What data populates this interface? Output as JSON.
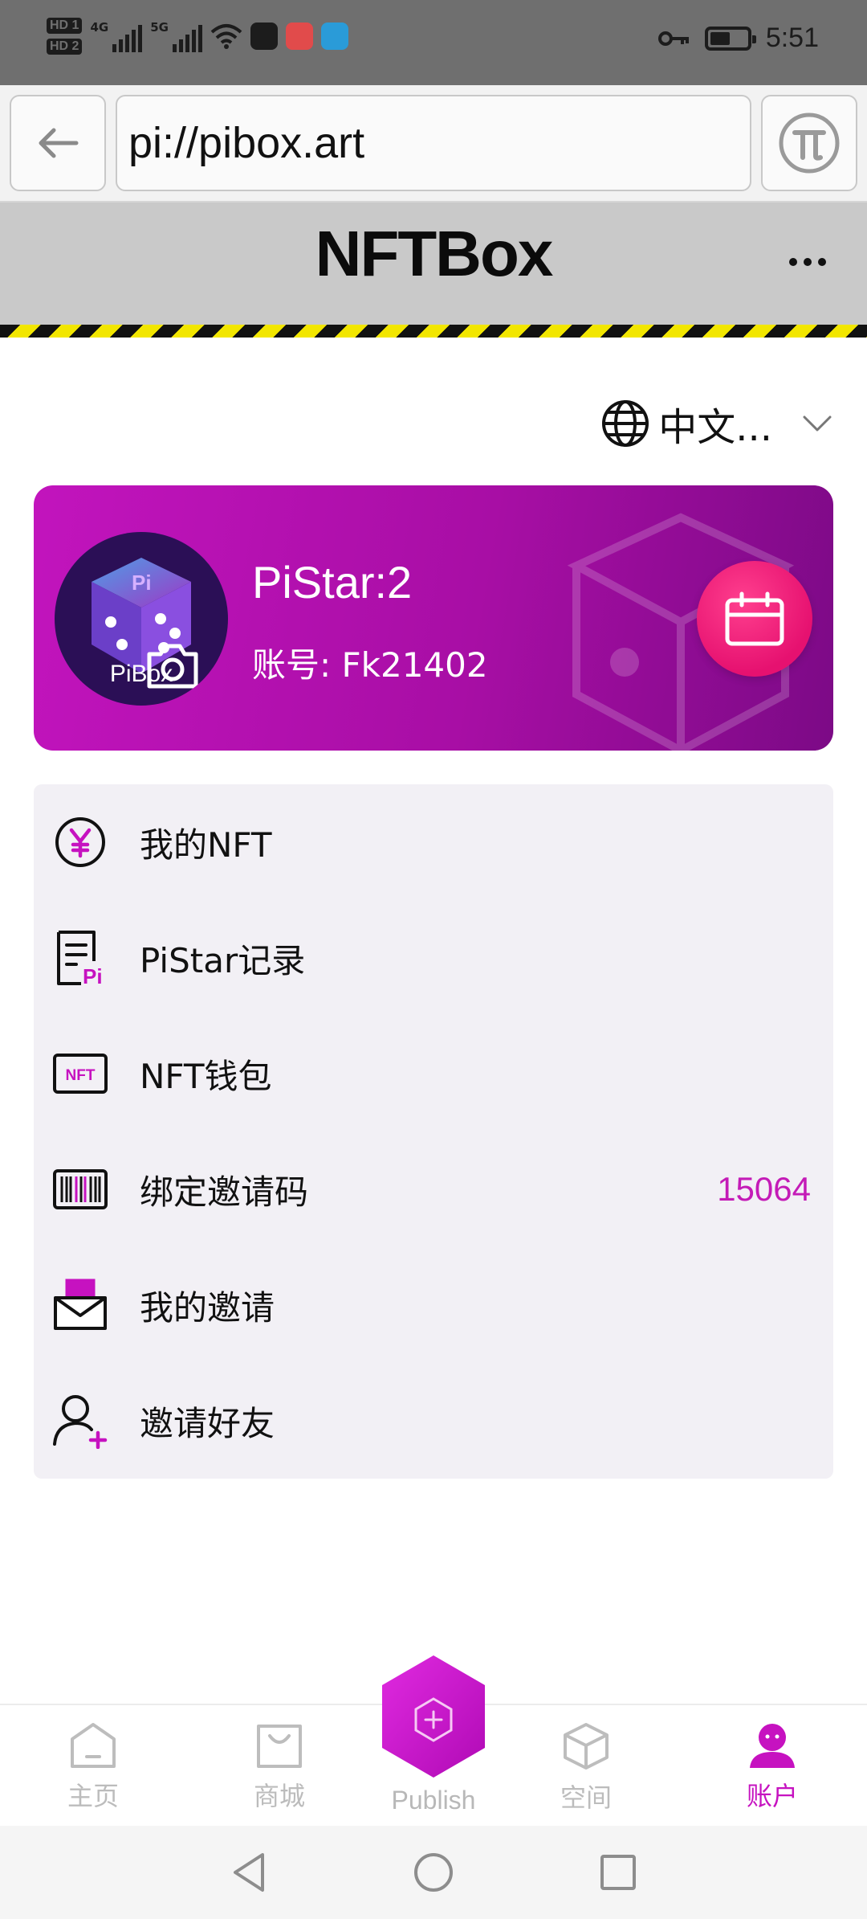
{
  "status_bar": {
    "hd1": "HD 1",
    "hd2": "HD 2",
    "net1": "4G",
    "net2": "5G",
    "time": "5:51",
    "battery_percent": 55
  },
  "browser": {
    "url": "pi://pibox.art"
  },
  "header": {
    "title": "NFTBox"
  },
  "language": {
    "label": "中文..."
  },
  "profile": {
    "avatar_text": "PiBox",
    "pistar": "PiStar:2",
    "account": "账号: Fk21402"
  },
  "menu": {
    "items": [
      {
        "label": "我的NFT",
        "icon": "yen-coin-icon"
      },
      {
        "label": "PiStar记录",
        "icon": "pi-document-icon"
      },
      {
        "label": "NFT钱包",
        "icon": "nft-wallet-icon"
      },
      {
        "label": "绑定邀请码",
        "icon": "barcode-icon",
        "value": "15064"
      },
      {
        "label": "我的邀请",
        "icon": "invite-envelope-icon"
      },
      {
        "label": "邀请好友",
        "icon": "add-friend-icon"
      }
    ]
  },
  "bottom_nav": {
    "home": "主页",
    "shop": "商城",
    "publish": "Publish",
    "space": "空间",
    "account": "账户",
    "active": "account"
  },
  "colors": {
    "accent": "#c612c0",
    "card_start": "#c214bd",
    "card_end": "#7c0a86",
    "calendar_button": "#e61170"
  }
}
